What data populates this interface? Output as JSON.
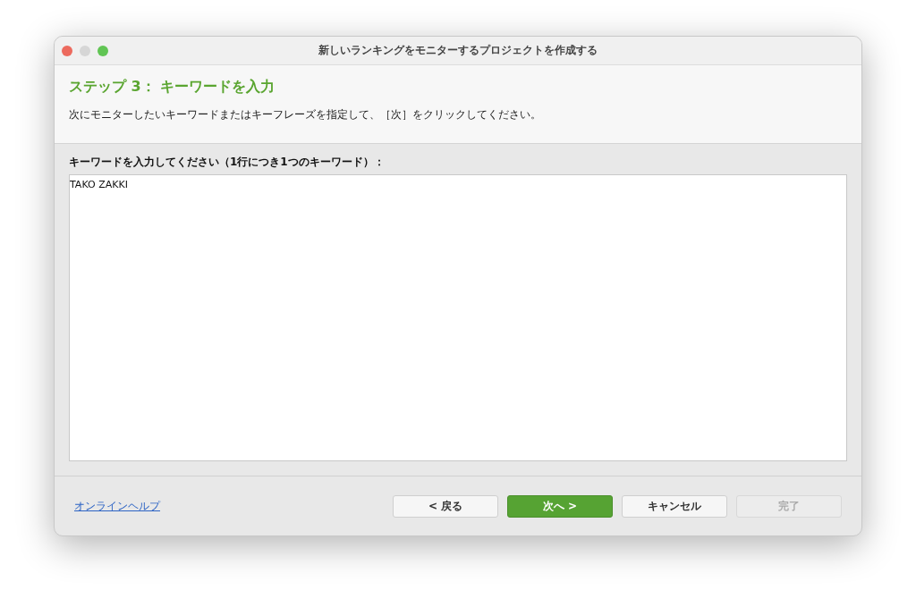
{
  "window": {
    "title": "新しいランキングをモニターするプロジェクトを作成する"
  },
  "header": {
    "step": "ステップ 3： キーワードを入力",
    "description": "次にモニターしたいキーワードまたはキーフレーズを指定して、［次］をクリックしてください。"
  },
  "keywords": {
    "label": "キーワードを入力してください（1行につき1つのキーワード）：",
    "value": "TAKO ZAKKI"
  },
  "footer": {
    "help_link": "オンラインヘルプ",
    "buttons": [
      {
        "label": "< 戻る",
        "kind": "default",
        "disabled": false
      },
      {
        "label": "次へ >",
        "kind": "primary",
        "disabled": false
      },
      {
        "label": "キャンセル",
        "kind": "default",
        "disabled": false
      },
      {
        "label": "完了",
        "kind": "default",
        "disabled": true
      }
    ]
  }
}
